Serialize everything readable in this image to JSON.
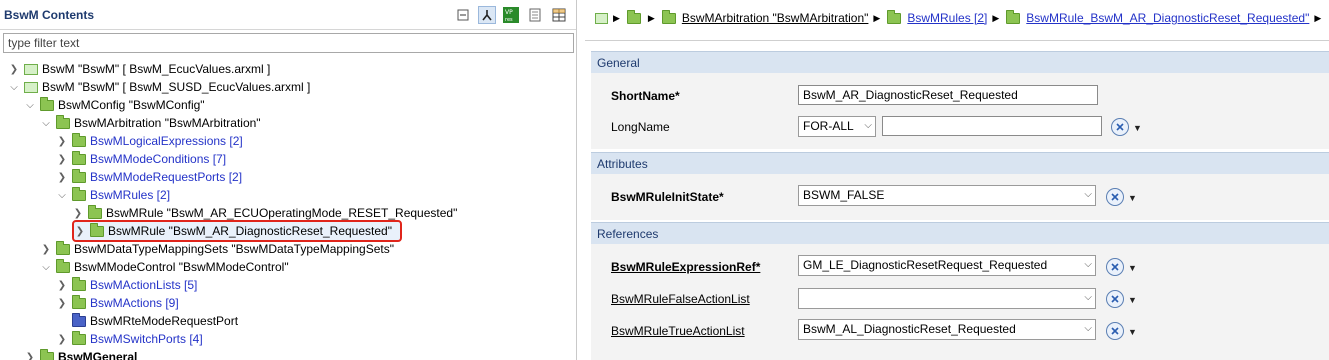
{
  "left": {
    "title": "BswM Contents",
    "filter_placeholder": "type filter text",
    "tree": [
      {
        "label": "BswM \"BswM\" [ BswM_EcucValues.arxml ]",
        "link": false,
        "bold": false
      },
      {
        "label": "BswM \"BswM\" [ BswM_SUSD_EcucValues.arxml ]",
        "link": false,
        "bold": false
      },
      {
        "label": "BswMConfig \"BswMConfig\"",
        "link": false,
        "bold": false
      },
      {
        "label": "BswMArbitration \"BswMArbitration\"",
        "link": false,
        "bold": false
      },
      {
        "label": "BswMLogicalExpressions [2]",
        "link": true,
        "bold": false
      },
      {
        "label": "BswMModeConditions [7]",
        "link": true,
        "bold": false
      },
      {
        "label": "BswMModeRequestPorts [2]",
        "link": true,
        "bold": false
      },
      {
        "label": "BswMRules [2]",
        "link": true,
        "bold": false
      },
      {
        "label": "BswMRule \"BswM_AR_ECUOperatingMode_RESET_Requested\"",
        "link": false,
        "bold": false
      },
      {
        "label": "BswMRule \"BswM_AR_DiagnosticReset_Requested\"",
        "link": false,
        "bold": false
      },
      {
        "label": "BswMDataTypeMappingSets \"BswMDataTypeMappingSets\"",
        "link": false,
        "bold": false
      },
      {
        "label": "BswMModeControl \"BswMModeControl\"",
        "link": false,
        "bold": false
      },
      {
        "label": "BswMActionLists [5]",
        "link": true,
        "bold": false
      },
      {
        "label": "BswMActions [9]",
        "link": true,
        "bold": false
      },
      {
        "label": "BswMRteModeRequestPort",
        "link": false,
        "bold": false
      },
      {
        "label": "BswMSwitchPorts [4]",
        "link": true,
        "bold": false
      },
      {
        "label": "BswMGeneral",
        "link": false,
        "bold": true
      }
    ]
  },
  "breadcrumb": {
    "item1": "BswMArbitration \"BswMArbitration\"",
    "item2": "BswMRules [2]",
    "item3": "BswMRule_BswM_AR_DiagnosticReset_Requested\""
  },
  "general": {
    "title": "General",
    "shortname_label": "ShortName*",
    "shortname_value": "BswM_AR_DiagnosticReset_Requested",
    "longname_label": "LongName",
    "longname_lang": "FOR-ALL",
    "longname_value": ""
  },
  "attributes": {
    "title": "Attributes",
    "initstate_label": "BswMRuleInitState*",
    "initstate_value": "BSWM_FALSE"
  },
  "references": {
    "title": "References",
    "expr_label": "BswMRuleExpressionRef*",
    "expr_value": "GM_LE_DiagnosticResetRequest_Requested",
    "false_label": "BswMRuleFalseActionList",
    "false_value": "",
    "true_label": "BswMRuleTrueActionList",
    "true_value": "BswM_AL_DiagnosticReset_Requested"
  },
  "colors": {
    "accent": "#2433c8",
    "folder_green": "#8cc452",
    "section_blue": "#d9e4f1",
    "highlight_red": "#e0251b"
  }
}
